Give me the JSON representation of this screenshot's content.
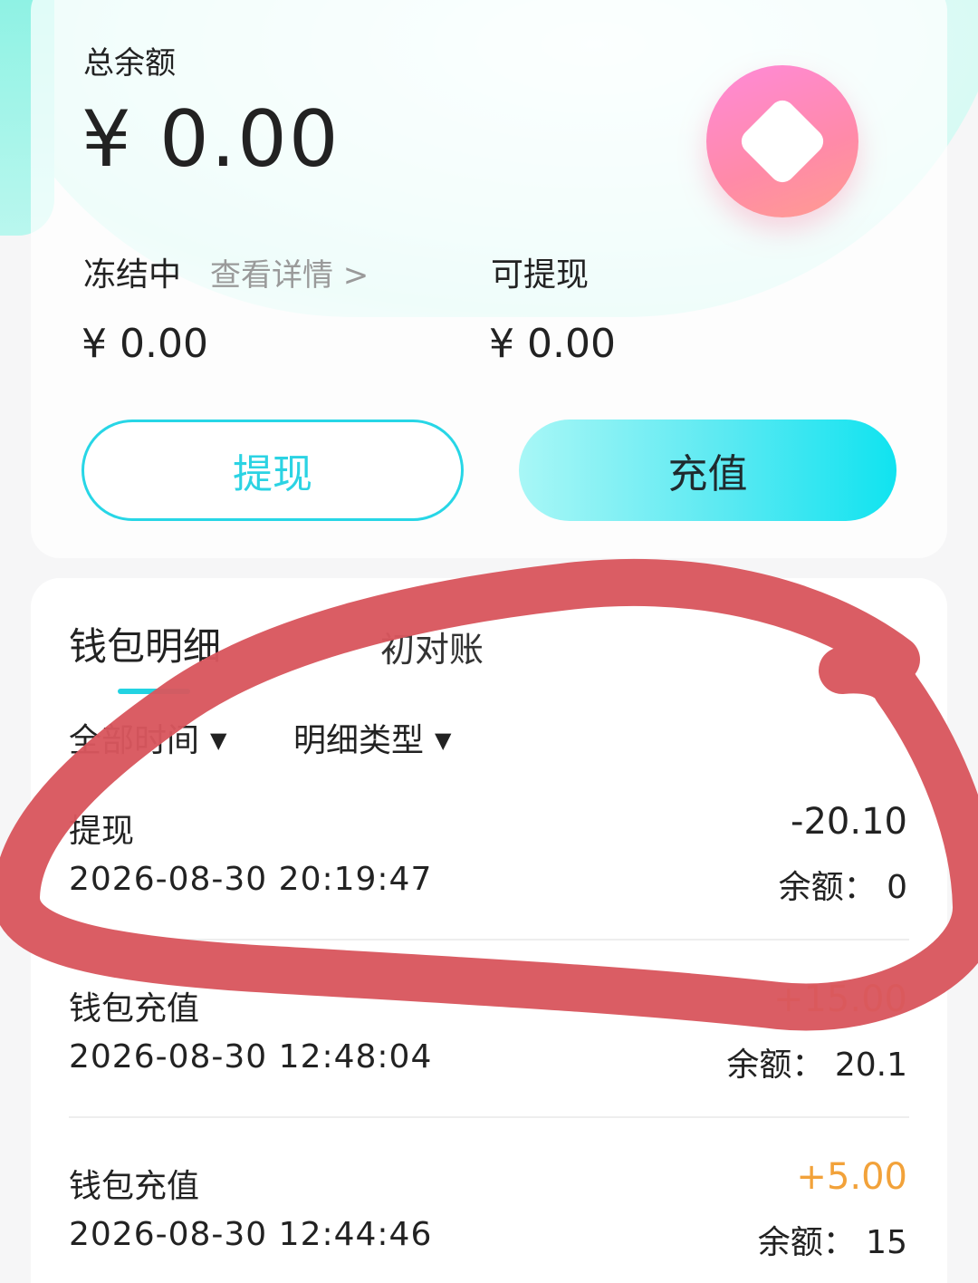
{
  "balance": {
    "total_label": "总余额",
    "total_amount": "¥ 0.00",
    "frozen_label": "冻结中",
    "detail_link": "查看详情 >",
    "frozen_amount": "¥ 0.00",
    "withdrawable_label": "可提现",
    "withdrawable_amount": "¥ 0.00",
    "coin_icon": "coin-icon"
  },
  "actions": {
    "withdraw_label": "提现",
    "recharge_label": "充值"
  },
  "tabs": {
    "wallet_label": "钱包明细",
    "other_label": "初对账"
  },
  "filters": {
    "time_label": "全部时间",
    "type_label": "明细类型"
  },
  "transactions": [
    {
      "title": "提现",
      "time": "2026-08-30 20:19:47",
      "amount": "-20.10",
      "balance": "余额： 0"
    },
    {
      "title": "钱包充值",
      "time": "2026-08-30 12:48:04",
      "amount": "+15.00",
      "balance": "余额： 20.1"
    },
    {
      "title": "钱包充值",
      "time": "2026-08-30 12:44:46",
      "amount": "+5.00",
      "balance": "余额： 15"
    }
  ],
  "colors": {
    "accent": "#22d3e2",
    "positive": "#f2a23a",
    "annotation": "#d9565e"
  }
}
